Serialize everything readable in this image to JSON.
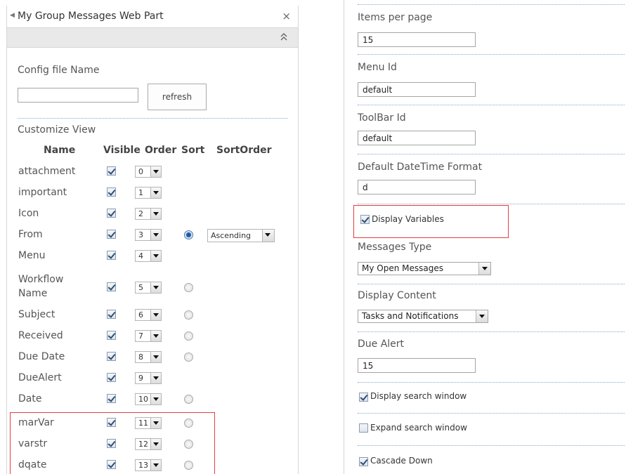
{
  "webpart": {
    "title": "My Group Messages Web Part",
    "close_symbol": "×"
  },
  "config": {
    "label": "Config file Name",
    "value": "",
    "refresh_label": "refresh"
  },
  "customize_view": {
    "label": "Customize View",
    "headers": {
      "name": "Name",
      "visible": "Visible",
      "order": "Order",
      "sort": "Sort",
      "sort_order": "SortOrder"
    },
    "rows": [
      {
        "name": "attachment",
        "visible": true,
        "order": "0",
        "sort": null
      },
      {
        "name": "important",
        "visible": true,
        "order": "1",
        "sort": null
      },
      {
        "name": "Icon",
        "visible": true,
        "order": "2",
        "sort": null
      },
      {
        "name": "From",
        "visible": true,
        "order": "3",
        "sort": "selected",
        "sort_order": "Ascending"
      },
      {
        "name": "Menu",
        "visible": true,
        "order": "4",
        "sort": null
      },
      {
        "name_line1": "Workflow",
        "name_line2": "Name",
        "visible": true,
        "order": "5",
        "sort": "unselected"
      },
      {
        "name": "Subject",
        "visible": true,
        "order": "6",
        "sort": "unselected"
      },
      {
        "name": "Received",
        "visible": true,
        "order": "7",
        "sort": "unselected"
      },
      {
        "name": "Due Date",
        "visible": true,
        "order": "8",
        "sort": "unselected"
      },
      {
        "name": "DueAlert",
        "visible": true,
        "order": "9",
        "sort": null
      },
      {
        "name": "Date",
        "visible": true,
        "order": "10",
        "sort": "unselected"
      },
      {
        "name": "marVar",
        "visible": true,
        "order": "11",
        "sort": "unselected"
      },
      {
        "name": "varstr",
        "visible": true,
        "order": "12",
        "sort": "unselected"
      },
      {
        "name": "dqate",
        "visible": true,
        "order": "13",
        "sort": "unselected"
      }
    ]
  },
  "settings": {
    "items_per_page": {
      "label": "Items per page",
      "value": "15"
    },
    "menu_id": {
      "label": "Menu Id",
      "value": "default"
    },
    "toolbar_id": {
      "label": "ToolBar Id",
      "value": "default"
    },
    "datetime_format": {
      "label": "Default DateTime Format",
      "value": "d"
    },
    "display_variables": {
      "label": "Display Variables",
      "checked": true
    },
    "messages_type": {
      "label": "Messages Type",
      "value": "My Open Messages"
    },
    "display_content": {
      "label": "Display Content",
      "value": "Tasks and Notifications"
    },
    "due_alert": {
      "label": "Due Alert",
      "value": "15"
    },
    "display_search_window": {
      "label": "Display search window",
      "checked": true
    },
    "expand_search_window": {
      "label": "Expand search window",
      "checked": false
    },
    "cascade_down": {
      "label": "Cascade Down",
      "checked": true
    }
  },
  "colors": {
    "highlight_border": "#e04040",
    "separator": "#8aa8c8",
    "header_bg": "#e9e9e9"
  }
}
